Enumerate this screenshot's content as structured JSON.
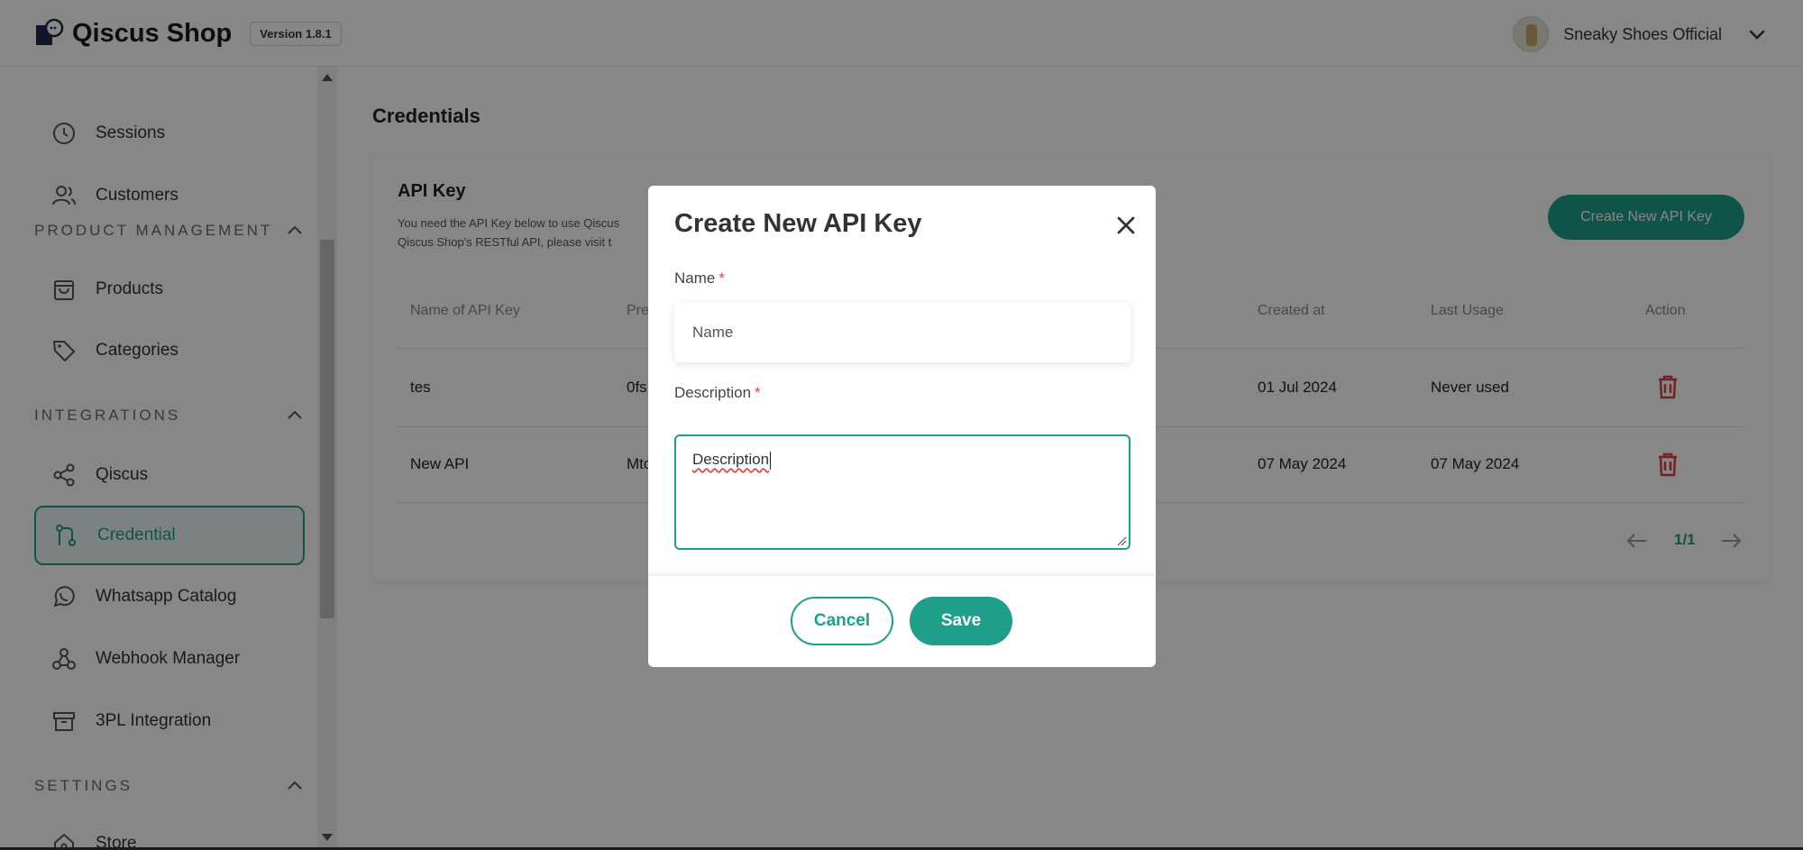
{
  "colors": {
    "accent": "#1f9e89",
    "danger": "#e04040"
  },
  "header": {
    "app_name": "Qiscus Shop",
    "version": "Version 1.8.1",
    "user_name": "Sneaky Shoes Official",
    "logo_icon": "qiscus-logo-icon",
    "dropdown_icon": "chevron-down-icon"
  },
  "sidebar": {
    "items": [
      {
        "label": "Sessions",
        "icon": "clock-icon"
      },
      {
        "label": "Customers",
        "icon": "users-icon"
      },
      {
        "label": "Products",
        "icon": "shopping-bag-icon"
      },
      {
        "label": "Categories",
        "icon": "tag-icon"
      },
      {
        "label": "Qiscus",
        "icon": "share-icon"
      },
      {
        "label": "Credential",
        "icon": "git-pull-icon",
        "active": true
      },
      {
        "label": "Whatsapp Catalog",
        "icon": "whatsapp-icon"
      },
      {
        "label": "Webhook Manager",
        "icon": "webhook-icon"
      },
      {
        "label": "3PL Integration",
        "icon": "archive-icon"
      },
      {
        "label": "Store",
        "icon": "home-icon"
      }
    ],
    "sections": [
      {
        "label": "PRODUCT MANAGEMENT"
      },
      {
        "label": "INTEGRATIONS"
      },
      {
        "label": "SETTINGS"
      }
    ]
  },
  "main": {
    "page_title": "Credentials",
    "card": {
      "title": "API Key",
      "desc_line1": "You need the API Key below to use Qiscus",
      "desc_line2": "Qiscus Shop's RESTful API, please visit t",
      "create_button": "Create New API Key"
    },
    "table": {
      "columns": [
        "Name of API Key",
        "Pre",
        "Created at",
        "Last Usage",
        "Action"
      ],
      "rows": [
        {
          "name": "tes",
          "prefix": "0fs",
          "created": "01 Jul 2024",
          "last_usage": "Never used"
        },
        {
          "name": "New API",
          "prefix": "Mtc",
          "created": "07 May 2024",
          "last_usage": "07 May 2024"
        }
      ]
    },
    "pagination": {
      "label": "1/1"
    }
  },
  "modal": {
    "title": "Create New API Key",
    "name_label": "Name",
    "name_placeholder": "Name",
    "description_label": "Description",
    "description_value": "Description",
    "required_mark": "*",
    "cancel": "Cancel",
    "save": "Save"
  }
}
